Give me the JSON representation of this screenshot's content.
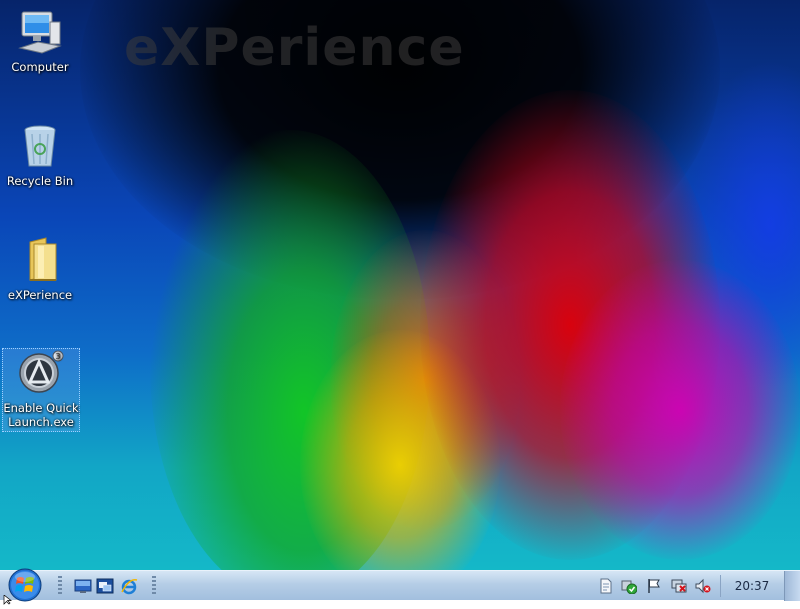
{
  "wallpaper": {
    "watermark_text": "eXPerience"
  },
  "desktop": {
    "icons": [
      {
        "label": "Computer",
        "icon": "computer-icon"
      },
      {
        "label": "Recycle Bin",
        "icon": "recycle-bin-icon"
      },
      {
        "label": "eXPerience",
        "icon": "folder-icon"
      },
      {
        "label": "Enable Quick Launch.exe",
        "icon": "application-icon",
        "selected": true
      }
    ]
  },
  "taskbar": {
    "start_icon": "windows-start-orb-icon",
    "quick_launch": [
      {
        "icon": "show-desktop-icon"
      },
      {
        "icon": "switch-windows-icon"
      },
      {
        "icon": "internet-explorer-icon"
      }
    ],
    "tray": [
      {
        "icon": "document-icon"
      },
      {
        "icon": "security-center-icon"
      },
      {
        "icon": "action-center-flag-icon"
      },
      {
        "icon": "network-disconnected-icon"
      },
      {
        "icon": "volume-muted-icon"
      }
    ],
    "clock": "20:37"
  },
  "colors": {
    "taskbar_top": "#d6e6f5",
    "taskbar_bottom": "#a2bfde",
    "wallpaper_blue": "#0a46b8",
    "wallpaper_red": "#dc000a",
    "wallpaper_green": "#12c81e",
    "wallpaper_magenta": "#d200b4"
  }
}
